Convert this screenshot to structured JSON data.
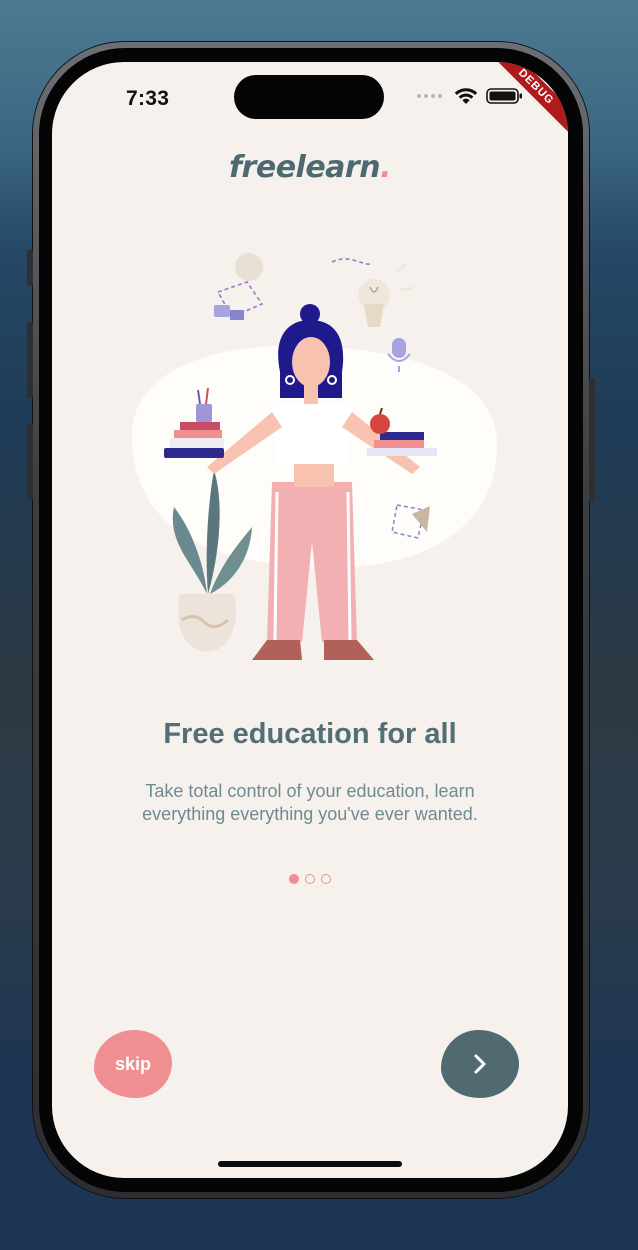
{
  "status_bar": {
    "time": "7:33",
    "icons": [
      "cellular-dots-icon",
      "wifi-icon",
      "battery-icon"
    ]
  },
  "debug_banner": "DEBUG",
  "logo": {
    "text": "freelearn",
    "dot": "."
  },
  "illustration": {
    "icon": "woman-balancing-books-illustration"
  },
  "onboarding": {
    "title": "Free education for all",
    "subtitle": "Take total control of your education, learn everything everything you've ever wanted.",
    "page_indicator": {
      "total": 3,
      "current": 1
    }
  },
  "buttons": {
    "skip_label": "skip",
    "next_icon": "chevron-right-icon"
  },
  "colors": {
    "accent_pink": "#ef8f91",
    "accent_teal": "#506a70",
    "background": "#f6f1ec",
    "title": "#546e76",
    "body": "#6f8a92"
  }
}
